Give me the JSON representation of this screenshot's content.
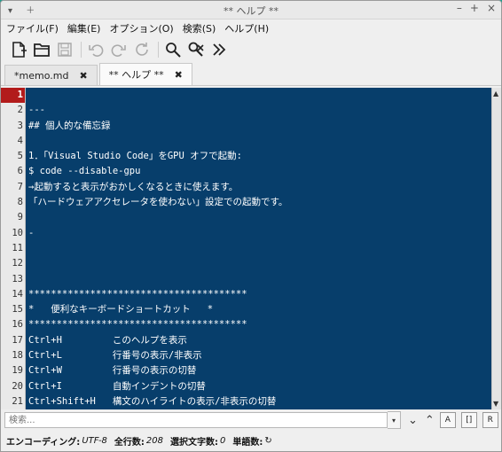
{
  "window": {
    "title": "** ヘルプ **"
  },
  "menu": [
    "ファイル(F)",
    "編集(E)",
    "オプション(O)",
    "検索(S)",
    "ヘルプ(H)"
  ],
  "tabs": [
    {
      "label": "*memo.md",
      "close": "✖"
    },
    {
      "label": "** ヘルプ **",
      "close": "✖"
    }
  ],
  "editor": {
    "current_line": 1,
    "lines": [
      {
        "n": "1",
        "t": ""
      },
      {
        "n": "2",
        "t": "---"
      },
      {
        "n": "3",
        "t": "## 個人的な備忘録"
      },
      {
        "n": "4",
        "t": ""
      },
      {
        "n": "5",
        "t": "1．「Visual Studio Code」をGPU オフで起動:"
      },
      {
        "n": "6",
        "t": "$ code --disable-gpu"
      },
      {
        "n": "7",
        "t": "→起動すると表示がおかしくなるときに使えます。"
      },
      {
        "n": "8",
        "t": "「ハードウェアアクセレータを使わない」設定での起動です。"
      },
      {
        "n": "9",
        "t": ""
      },
      {
        "n": "10",
        "t": "-"
      },
      {
        "n": "11",
        "t": ""
      },
      {
        "n": "12",
        "t": ""
      },
      {
        "n": "13",
        "t": ""
      },
      {
        "n": "14",
        "t": "***************************************"
      },
      {
        "n": "15",
        "t": "*   便利なキーボードショートカット   *"
      },
      {
        "n": "16",
        "t": "***************************************"
      },
      {
        "n": "17",
        "t": "Ctrl+H         このヘルプを表示"
      },
      {
        "n": "18",
        "t": "Ctrl+L         行番号の表示/非表示"
      },
      {
        "n": "19",
        "t": "Ctrl+W         行番号の表示の切替"
      },
      {
        "n": "20",
        "t": "Ctrl+I         自動インデントの切替"
      },
      {
        "n": "21",
        "t": "Ctrl+Shift+H   構文のハイライトの表示/非表示の切替"
      }
    ]
  },
  "search": {
    "placeholder": "検索..."
  },
  "status": {
    "encoding_label": "エンコーディング:",
    "encoding_value": "UTF-8",
    "lines_label": "全行数:",
    "lines_value": "208",
    "selected_label": "選択文字数:",
    "selected_value": "0",
    "words_label": "単語数:"
  }
}
